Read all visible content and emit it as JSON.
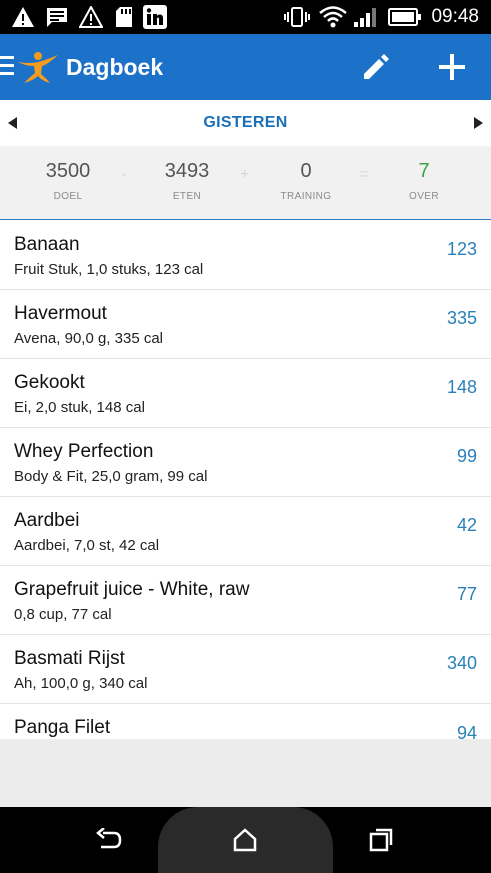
{
  "status_bar": {
    "time": "09:48",
    "icons": [
      "warning-icon",
      "message-icon",
      "warning-outline-icon",
      "sd-card-icon",
      "linkedin-icon",
      "vibrate-icon",
      "wifi-icon",
      "signal-icon",
      "battery-icon"
    ]
  },
  "app_bar": {
    "title": "Dagboek",
    "background_color": "#1b72c8",
    "icons": [
      "menu-icon",
      "app-logo-icon",
      "edit-icon",
      "add-icon"
    ]
  },
  "date_nav": {
    "label": "GISTEREN",
    "prev_icon": "arrow-left-icon",
    "next_icon": "arrow-right-icon"
  },
  "summary": {
    "goal": {
      "value": "3500",
      "label": "DOEL"
    },
    "op1": "-",
    "eaten": {
      "value": "3493",
      "label": "ETEN"
    },
    "op2": "+",
    "exercise": {
      "value": "0",
      "label": "TRAINING"
    },
    "op3": "=",
    "remaining": {
      "value": "7",
      "label": "OVER",
      "color": "#3aa542"
    }
  },
  "entries": [
    {
      "name": "Banaan",
      "desc": "Fruit Stuk, 1,0 stuks, 123 cal",
      "cal": "123"
    },
    {
      "name": "Havermout",
      "desc": "Avena, 90,0 g, 335 cal",
      "cal": "335"
    },
    {
      "name": "Gekookt",
      "desc": "Ei, 2,0 stuk, 148 cal",
      "cal": "148"
    },
    {
      "name": "Whey Perfection",
      "desc": "Body & Fit, 25,0 gram, 99 cal",
      "cal": "99"
    },
    {
      "name": "Aardbei",
      "desc": "Aardbei, 7,0 st, 42 cal",
      "cal": "42"
    },
    {
      "name": "Grapefruit juice - White, raw",
      "desc": "0,8 cup, 77 cal",
      "cal": "77"
    },
    {
      "name": "Basmati Rijst",
      "desc": "Ah, 100,0 g, 340 cal",
      "cal": "340"
    },
    {
      "name": "Panga Filet",
      "desc": "",
      "cal": "94"
    }
  ],
  "nav_bar": {
    "icons": [
      "back-icon",
      "home-icon",
      "recents-icon"
    ]
  }
}
